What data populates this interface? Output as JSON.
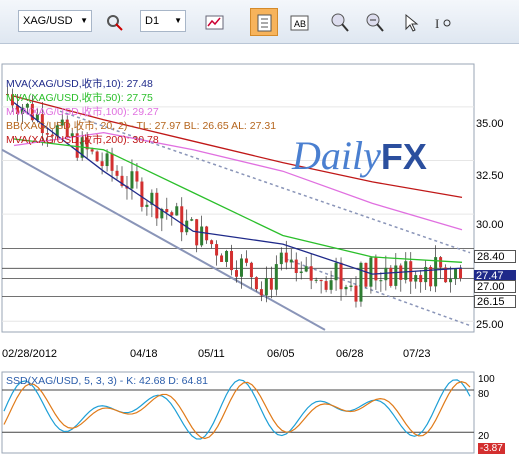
{
  "toolbar": {
    "symbol": "XAG/USD",
    "timeframe": "D1",
    "icons": [
      "symbol-dropdown-icon",
      "chart-search-icon",
      "chart-type-icon",
      "bar-chart-icon",
      "data-window-icon",
      "zoom-in-icon",
      "zoom-out-icon",
      "pointer-tool-icon",
      "text-tool-icon"
    ]
  },
  "legend": {
    "mva10": "MVA(XAG/USD,收市,10): 27.48",
    "mva50": "MVA(XAG/USD,收市,50): 27.75",
    "mva100": "MVA(XAG/USD,收市,100): 29.27",
    "bb": "BB(XAG/USD,收市, 20, 2) - TL: 27.97  BL: 26.65  AL: 27.31",
    "mva200": "MVA(XAG/USD,收市,200): 30.78"
  },
  "logo": {
    "part1": "Daily",
    "part2": "FX"
  },
  "price_axis": {
    "ticks": [
      "35.00",
      "32.50",
      "30.00",
      "25.00"
    ],
    "levels": [
      "28.40",
      "27.47",
      "27.00",
      "26.15"
    ]
  },
  "date_axis": [
    "02/28/2012",
    "04/18",
    "05/11",
    "06/05",
    "06/28",
    "07/23"
  ],
  "oscillator": {
    "label": "SSD(XAG/USD, 5, 3, 3) - K: 42.68  D: 64.81",
    "ticks": [
      "100",
      "80",
      "20",
      "-3.87"
    ]
  },
  "colors": {
    "mva10": "#1f2a8a",
    "mva50": "#2bbf2b",
    "mva100": "#e070e0",
    "mva200": "#c01818",
    "bb": "#b5651d",
    "bull_candle": "#2e7d32",
    "bear_candle": "#d32f2f",
    "logo_blue": "#4a7fd0"
  },
  "chart_data": {
    "type": "line",
    "title": "XAG/USD D1",
    "x": [
      "02/28/2012",
      "04/18",
      "05/11",
      "06/05",
      "06/28",
      "07/23"
    ],
    "series": [
      {
        "name": "MVA(XAG/USD,收市,10)",
        "values": [
          35.2,
          32.0,
          29.2,
          28.6,
          27.2,
          27.48
        ]
      },
      {
        "name": "MVA(XAG/USD,收市,50)",
        "values": [
          33.5,
          33.0,
          31.0,
          29.0,
          28.0,
          27.75
        ]
      },
      {
        "name": "MVA(XAG/USD,收市,100)",
        "values": [
          33.2,
          33.8,
          33.0,
          32.0,
          30.5,
          29.27
        ]
      },
      {
        "name": "MVA(XAG/USD,收市,200)",
        "values": [
          35.5,
          34.4,
          33.4,
          32.4,
          31.5,
          30.78
        ]
      }
    ],
    "ylim": [
      24.5,
      37.0
    ],
    "yticks": [
      25.0,
      30.0,
      32.5,
      35.0
    ]
  }
}
